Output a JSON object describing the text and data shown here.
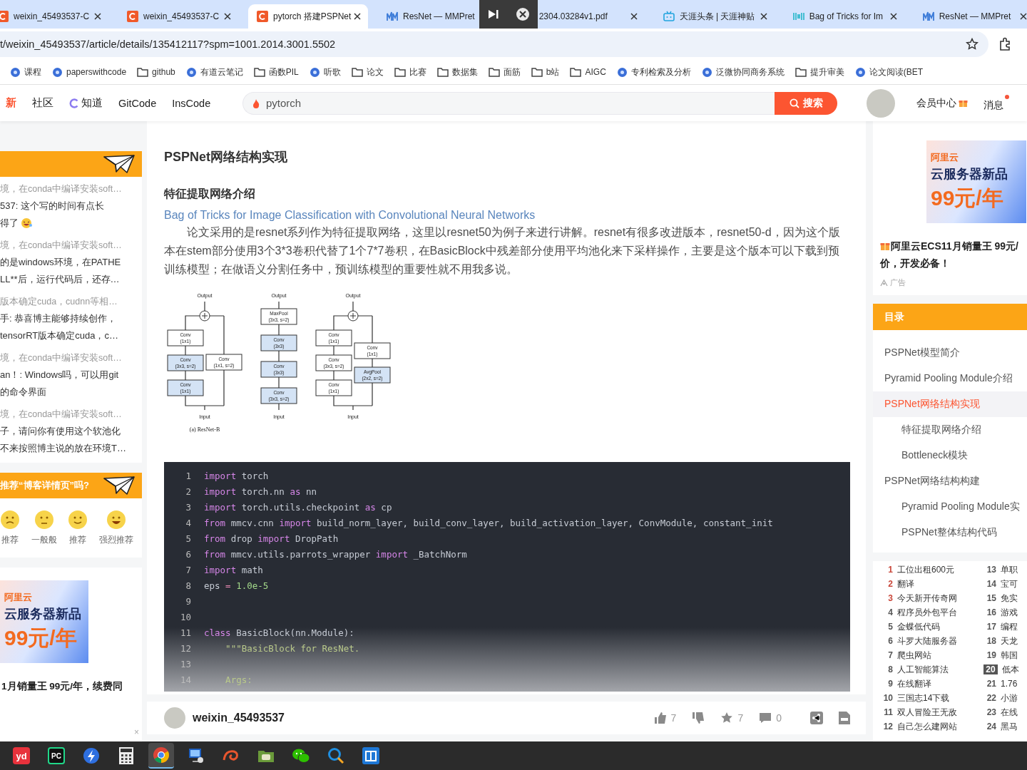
{
  "browser": {
    "tabs": [
      {
        "title": "weixin_45493537-C",
        "kind": "csdn",
        "selected": false
      },
      {
        "title": "weixin_45493537-C",
        "kind": "csdn",
        "selected": false
      },
      {
        "title": "pytorch 搭建PSPNet",
        "kind": "csdn",
        "selected": true
      },
      {
        "title": "ResNet — MMPret",
        "kind": "mm",
        "selected": false
      },
      {
        "title": "2304.03284v1.pdf",
        "kind": "plain",
        "selected": false
      },
      {
        "title": "天涯头条 | 天涯神贴",
        "kind": "tv",
        "selected": false
      },
      {
        "title": "Bag of Tricks for Im",
        "kind": "pwc",
        "selected": false
      },
      {
        "title": "ResNet — MMPret",
        "kind": "mm",
        "selected": false
      }
    ],
    "address": "t/weixin_45493537/article/details/135412117?spm=1001.2014.3001.5502",
    "bookmarks": [
      {
        "label": "课程",
        "kind": "site"
      },
      {
        "label": "paperswithcode",
        "kind": "site"
      },
      {
        "label": "github",
        "kind": "folder"
      },
      {
        "label": "有道云笔记",
        "kind": "site"
      },
      {
        "label": "函数PIL",
        "kind": "folder"
      },
      {
        "label": "听歌",
        "kind": "site"
      },
      {
        "label": "论文",
        "kind": "folder"
      },
      {
        "label": "比赛",
        "kind": "folder"
      },
      {
        "label": "数据集",
        "kind": "folder"
      },
      {
        "label": "面筋",
        "kind": "folder"
      },
      {
        "label": "b站",
        "kind": "folder"
      },
      {
        "label": "AIGC",
        "kind": "folder"
      },
      {
        "label": "专利检索及分析",
        "kind": "site"
      },
      {
        "label": "泛微协同商务系统",
        "kind": "site"
      },
      {
        "label": "提升审美",
        "kind": "folder"
      },
      {
        "label": "论文阅读(BET",
        "kind": "site"
      }
    ]
  },
  "header": {
    "nav": [
      {
        "label": "新",
        "kind": "new"
      },
      {
        "label": "社区",
        "kind": "plain"
      },
      {
        "label": "知道",
        "kind": "icon"
      },
      {
        "label": "GitCode",
        "kind": "plain"
      },
      {
        "label": "InsCode",
        "kind": "plain"
      }
    ],
    "search": {
      "placeholder": "pytorch",
      "button": "搜索"
    },
    "vip": "会员中心",
    "messages": {
      "label": "消息",
      "unread": true
    }
  },
  "left_sidebar": {
    "comments": [
      {
        "source": "境，在conda中编译安装soft…",
        "lines": [
          "537: 这个写的时间有点长",
          "得了"
        ],
        "emoji": true
      },
      {
        "source": "境，在conda中编译安装soft…",
        "lines": [
          "的是windows环境，在PATHE",
          "LL**后，运行代码后，还存…"
        ],
        "emoji": false
      },
      {
        "source": "版本确定cuda，cudnn等相…",
        "lines": [
          "手: 恭喜博主能够持续创作，",
          "tensorRT版本确定cuda，c…"
        ],
        "emoji": false
      },
      {
        "source": "境，在conda中编译安装soft…",
        "lines": [
          "an！: Windows吗，可以用git",
          "的命令界面"
        ],
        "emoji": false
      },
      {
        "source": "境，在conda中编译安装soft…",
        "lines": [
          "子，请问你有使用这个软池化",
          "不来按照博主说的放在环境T…"
        ],
        "emoji": false
      }
    ],
    "survey": {
      "title": "推荐“博客详情页”吗?",
      "options": [
        {
          "label": "推荐",
          "kind": "frown"
        },
        {
          "label": "一般般",
          "kind": "neutral"
        },
        {
          "label": "推荐",
          "kind": "smile"
        },
        {
          "label": "强烈推荐",
          "kind": "laugh"
        }
      ]
    },
    "ad": {
      "brand": "阿里云",
      "headline": "云服务器新品",
      "price": "99元/年",
      "text": "1月销量王 99元/年，续费同",
      "close": "×"
    }
  },
  "article": {
    "heading": "PSPNet网络结构实现",
    "subheading": "特征提取网络介绍",
    "link": "Bag of Tricks for Image Classification with Convolutional Neural Networks",
    "paragraph": "论文采用的是resnet系列作为特征提取网络，这里以resnet50为例子来进行讲解。resnet有很多改进版本，resnet50-d，因为这个版本在stem部分使用3个3*3卷积代替了1个7*7卷积，在BasicBlock中残差部分使用平均池化来下采样操作，主要是这个版本可以下载到预训练模型；在做语义分割任务中，预训练模型的重要性就不用我多说。",
    "figure": {
      "columns": [
        {
          "output": "Output",
          "input": "Input",
          "sum": true,
          "caption": "(a) ResNet-B",
          "main": [
            {
              "lines": [
                "Conv",
                "(1x1)"
              ],
              "shaded": false
            },
            {
              "lines": [
                "Conv",
                "(3x3, s=2)"
              ],
              "shaded": true
            },
            {
              "lines": [
                "Conv",
                "(1x1)"
              ],
              "shaded": true
            }
          ],
          "side": [
            {
              "lines": [
                "Conv",
                "(1x1, s=2)"
              ],
              "shaded": false
            }
          ]
        },
        {
          "output": "Output",
          "input": "Input",
          "sum": false,
          "main": [
            {
              "lines": [
                "MaxPool",
                "(3x3, s=2)"
              ],
              "shaded": false
            },
            {
              "lines": [
                "Conv",
                "(3x3)"
              ],
              "shaded": true
            },
            {
              "lines": [
                "Conv",
                "(3x3)"
              ],
              "shaded": true
            },
            {
              "lines": [
                "Conv",
                "(3x3, s=2)"
              ],
              "shaded": true
            }
          ]
        },
        {
          "output": "Output",
          "input": "Input",
          "sum": true,
          "main": [
            {
              "lines": [
                "Conv",
                "(1x1)"
              ],
              "shaded": false
            },
            {
              "lines": [
                "Conv",
                "(3x3, s=2)"
              ],
              "shaded": false
            },
            {
              "lines": [
                "Conv",
                "(1x1)"
              ],
              "shaded": false
            }
          ],
          "side": [
            {
              "lines": [
                "Conv",
                "(1x1)"
              ],
              "shaded": false
            },
            {
              "lines": [
                "AvgPool",
                "(2x2, s=2)"
              ],
              "shaded": true
            }
          ]
        }
      ]
    },
    "code": [
      {
        "number": "1",
        "tokens": [
          {
            "kind": "keyword",
            "text": "import"
          },
          {
            "kind": "name",
            "text": " torch"
          }
        ]
      },
      {
        "number": "2",
        "tokens": [
          {
            "kind": "keyword",
            "text": "import"
          },
          {
            "kind": "name",
            "text": " torch.nn "
          },
          {
            "kind": "keyword",
            "text": "as"
          },
          {
            "kind": "name",
            "text": " nn"
          }
        ]
      },
      {
        "number": "3",
        "tokens": [
          {
            "kind": "keyword",
            "text": "import"
          },
          {
            "kind": "name",
            "text": " torch.utils.checkpoint "
          },
          {
            "kind": "keyword",
            "text": "as"
          },
          {
            "kind": "name",
            "text": " cp"
          }
        ]
      },
      {
        "number": "4",
        "tokens": [
          {
            "kind": "keyword",
            "text": "from"
          },
          {
            "kind": "name",
            "text": " mmcv.cnn "
          },
          {
            "kind": "keyword",
            "text": "import"
          },
          {
            "kind": "name",
            "text": " build_norm_layer, build_conv_layer, build_activation_layer, ConvModule, constant_init"
          }
        ]
      },
      {
        "number": "5",
        "tokens": [
          {
            "kind": "keyword",
            "text": "from"
          },
          {
            "kind": "name",
            "text": " drop "
          },
          {
            "kind": "keyword",
            "text": "import"
          },
          {
            "kind": "name",
            "text": " DropPath"
          }
        ]
      },
      {
        "number": "6",
        "tokens": [
          {
            "kind": "keyword",
            "text": "from"
          },
          {
            "kind": "name",
            "text": " mmcv.utils.parrots_wrapper "
          },
          {
            "kind": "keyword",
            "text": "import"
          },
          {
            "kind": "name",
            "text": " _BatchNorm"
          }
        ]
      },
      {
        "number": "7",
        "tokens": [
          {
            "kind": "keyword",
            "text": "import"
          },
          {
            "kind": "name",
            "text": " math"
          }
        ]
      },
      {
        "number": "8",
        "tokens": [
          {
            "kind": "name",
            "text": "eps "
          },
          {
            "kind": "operator",
            "text": "="
          },
          {
            "kind": "number",
            "text": " 1.0e-5"
          }
        ]
      },
      {
        "number": "9"
      },
      {
        "number": "10"
      },
      {
        "number": "11",
        "tokens": [
          {
            "kind": "keyword",
            "text": "class"
          },
          {
            "kind": "name",
            "text": " BasicBlock(nn.Module):"
          }
        ]
      },
      {
        "number": "12",
        "tokens": [
          {
            "kind": "string",
            "text": "    \"\"\"BasicBlock for ResNet."
          }
        ]
      },
      {
        "number": "13"
      },
      {
        "number": "14",
        "tokens": [
          {
            "kind": "string",
            "text": "    Args:"
          }
        ]
      }
    ],
    "footer": {
      "author": "weixin_45493537",
      "likes": "7",
      "favorites": "7",
      "comments": "0"
    }
  },
  "right_sidebar": {
    "ad": {
      "brand": "阿里云",
      "headline": "云服务器新品",
      "price": "99元/年",
      "text": "阿里云ECS11月销量王 99元/",
      "text2": "价，开发必备！",
      "label": "广告"
    },
    "toc": {
      "title": "目录",
      "items": [
        {
          "label": "PSPNet模型简介",
          "selected": false
        },
        {
          "label": "Pyramid Pooling Module介绍",
          "selected": false
        },
        {
          "label": "PSPNet网络结构实现",
          "selected": true,
          "children": [
            {
              "label": "特征提取网络介绍",
              "selected": false
            },
            {
              "label": "Bottleneck模块",
              "selected": false
            }
          ]
        },
        {
          "label": "PSPNet网络结构构建",
          "selected": false,
          "children": [
            {
              "label": "Pyramid Pooling Module实",
              "selected": false
            },
            {
              "label": "PSPNet整体结构代码",
              "selected": false
            }
          ]
        }
      ]
    },
    "hot": [
      {
        "rank": "1",
        "title": "工位出租600元",
        "color": "#c9473a",
        "selected": false
      },
      {
        "rank": "13",
        "title": "单职",
        "color": "#555555",
        "selected": false
      },
      {
        "rank": "2",
        "title": "翻译",
        "color": "#c9473a",
        "selected": false
      },
      {
        "rank": "14",
        "title": "宝可",
        "color": "#555555",
        "selected": false
      },
      {
        "rank": "3",
        "title": "今天新开传奇网",
        "color": "#c9473a",
        "selected": false
      },
      {
        "rank": "15",
        "title": "免实",
        "color": "#555555",
        "selected": false
      },
      {
        "rank": "4",
        "title": "程序员外包平台",
        "color": "#555555",
        "selected": false
      },
      {
        "rank": "16",
        "title": "游戏",
        "color": "#555555",
        "selected": false
      },
      {
        "rank": "5",
        "title": "金蝶低代码",
        "color": "#555555",
        "selected": false
      },
      {
        "rank": "17",
        "title": "编程",
        "color": "#555555",
        "selected": false
      },
      {
        "rank": "6",
        "title": "斗罗大陆服务器",
        "color": "#555555",
        "selected": false
      },
      {
        "rank": "18",
        "title": "天龙",
        "color": "#555555",
        "selected": false
      },
      {
        "rank": "7",
        "title": "爬虫网站",
        "color": "#555555",
        "selected": false
      },
      {
        "rank": "19",
        "title": "韩国",
        "color": "#555555",
        "selected": false
      },
      {
        "rank": "8",
        "title": "人工智能算法",
        "color": "#555555",
        "selected": false
      },
      {
        "rank": "20",
        "title": "低本",
        "color": "#555555",
        "selected": true
      },
      {
        "rank": "9",
        "title": "在线翻译",
        "color": "#555555",
        "selected": false
      },
      {
        "rank": "21",
        "title": "1.76",
        "color": "#555555",
        "selected": false
      },
      {
        "rank": "10",
        "title": "三国志14下载",
        "color": "#555555",
        "selected": false
      },
      {
        "rank": "22",
        "title": "小游",
        "color": "#555555",
        "selected": false
      },
      {
        "rank": "11",
        "title": "双人冒险王无敌",
        "color": "#555555",
        "selected": false
      },
      {
        "rank": "23",
        "title": "在线",
        "color": "#555555",
        "selected": false
      },
      {
        "rank": "12",
        "title": "自己怎么建网站",
        "color": "#555555",
        "selected": false
      },
      {
        "rank": "24",
        "title": "黑马",
        "color": "#555555",
        "selected": false
      }
    ]
  },
  "taskbar": [
    {
      "kind": "youdao",
      "label": "yd",
      "selected": false
    },
    {
      "kind": "pycharm",
      "label": "PC",
      "selected": false
    },
    {
      "kind": "arrow",
      "selected": false
    },
    {
      "kind": "calculator",
      "selected": false
    },
    {
      "kind": "chrome",
      "selected": true
    },
    {
      "kind": "remote",
      "selected": false
    },
    {
      "kind": "swirl",
      "selected": false
    },
    {
      "kind": "folder",
      "selected": false
    },
    {
      "kind": "wechat",
      "selected": false
    },
    {
      "kind": "search",
      "selected": false
    },
    {
      "kind": "box",
      "selected": false
    }
  ]
}
